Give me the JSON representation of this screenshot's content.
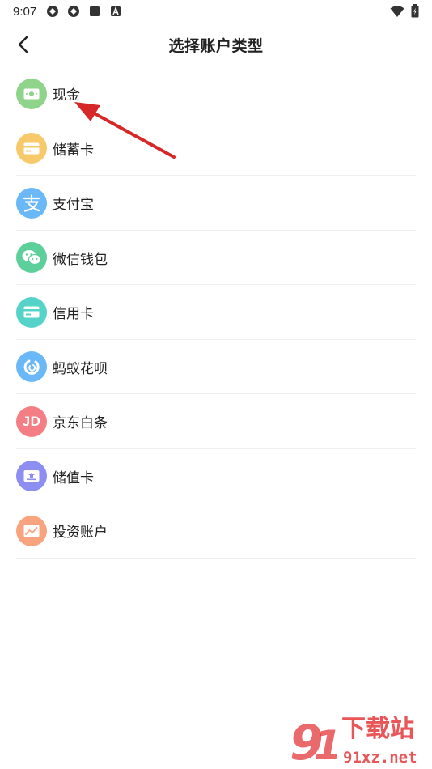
{
  "status_bar": {
    "time": "9:07"
  },
  "header": {
    "title": "选择账户类型"
  },
  "account_types": [
    {
      "label": "现金",
      "icon": "cash-icon",
      "color": "#8fd48a"
    },
    {
      "label": "储蓄卡",
      "icon": "savings-card-icon",
      "color": "#f7c96b"
    },
    {
      "label": "支付宝",
      "icon": "alipay-icon",
      "color": "#6ab8f7"
    },
    {
      "label": "微信钱包",
      "icon": "wechat-icon",
      "color": "#5dcf9a"
    },
    {
      "label": "信用卡",
      "icon": "credit-card-icon",
      "color": "#56d3c8"
    },
    {
      "label": "蚂蚁花呗",
      "icon": "huabei-icon",
      "color": "#6ab8f7"
    },
    {
      "label": "京东白条",
      "icon": "jd-icon",
      "color": "#f57e85"
    },
    {
      "label": "储值卡",
      "icon": "stored-value-card-icon",
      "color": "#8c8ef2"
    },
    {
      "label": "投资账户",
      "icon": "investment-icon",
      "color": "#f9a37f"
    }
  ],
  "icon_texts": {
    "jd": "JD"
  },
  "watermark": {
    "main": "下载站",
    "domain": "91xz.net",
    "color": "#e4393c"
  },
  "annotation_color": "#d62828"
}
